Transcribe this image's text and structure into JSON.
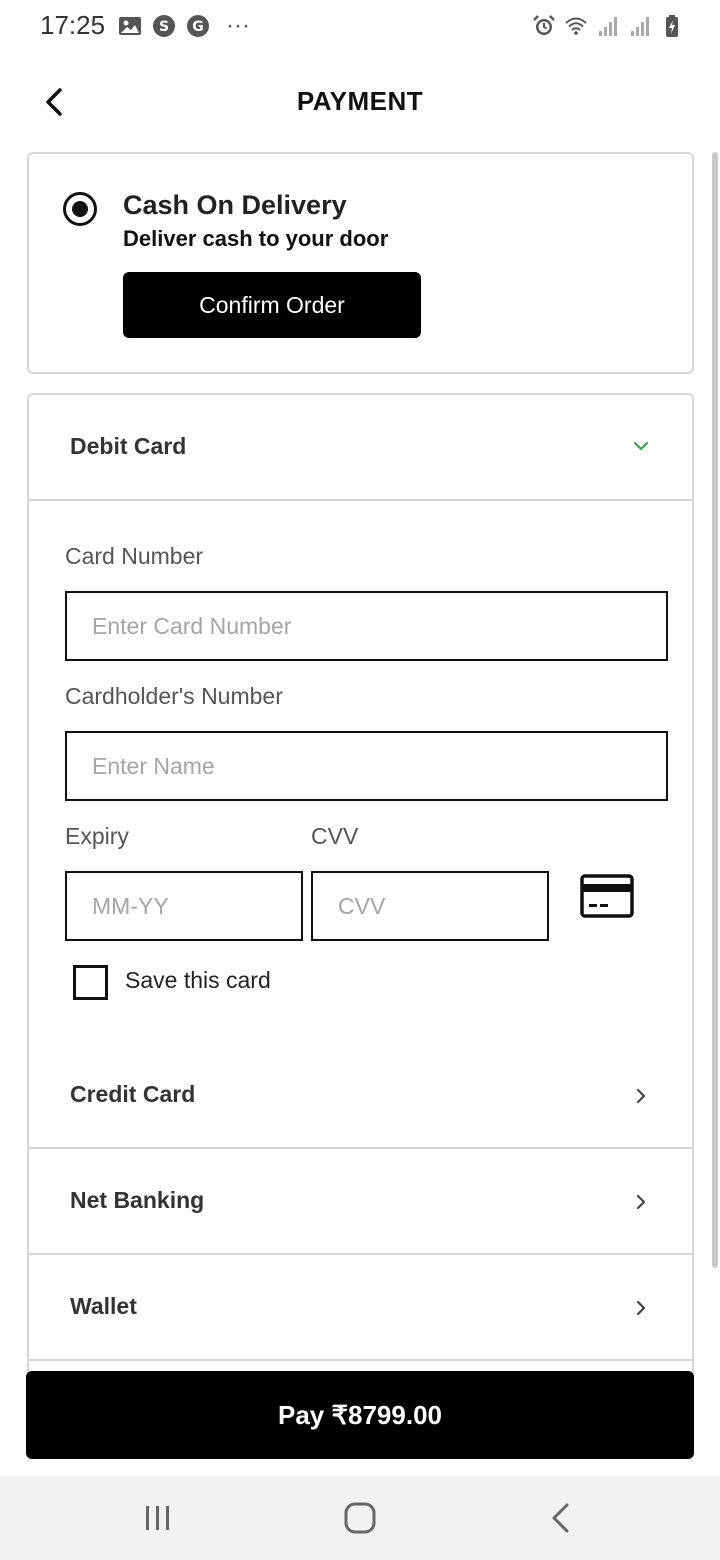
{
  "status_bar": {
    "time": "17:25",
    "more": "···",
    "left_icons": [
      "gallery-icon",
      "skype-icon",
      "google-icon"
    ],
    "right_icons": [
      "alarm-icon",
      "wifi-icon",
      "signal-icon",
      "signal-icon",
      "battery-icon"
    ]
  },
  "header": {
    "title": "PAYMENT",
    "back_icon": "chevron-left-icon"
  },
  "cod": {
    "title": "Cash On Delivery",
    "subtitle": "Deliver cash to your door",
    "confirm_label": "Confirm Order",
    "selected": true
  },
  "debit_card": {
    "label": "Debit Card",
    "expanded": true,
    "chevron_color": "#2eaa3c",
    "card_number_label": "Card Number",
    "card_number_placeholder": "Enter Card Number",
    "cardholder_label": "Cardholder's Number",
    "cardholder_placeholder": "Enter Name",
    "expiry_label": "Expiry",
    "expiry_placeholder": "MM-YY",
    "cvv_label": "CVV",
    "cvv_placeholder": "CVV",
    "save_label": "Save this card",
    "save_checked": false
  },
  "options": [
    {
      "label": "Credit Card"
    },
    {
      "label": "Net Banking"
    },
    {
      "label": "Wallet"
    }
  ],
  "pay_button": {
    "label": "Pay ₹8799.00"
  },
  "colors": {
    "primary": "#000000",
    "border": "#d6d6d6",
    "accent_green": "#2eaa3c"
  }
}
